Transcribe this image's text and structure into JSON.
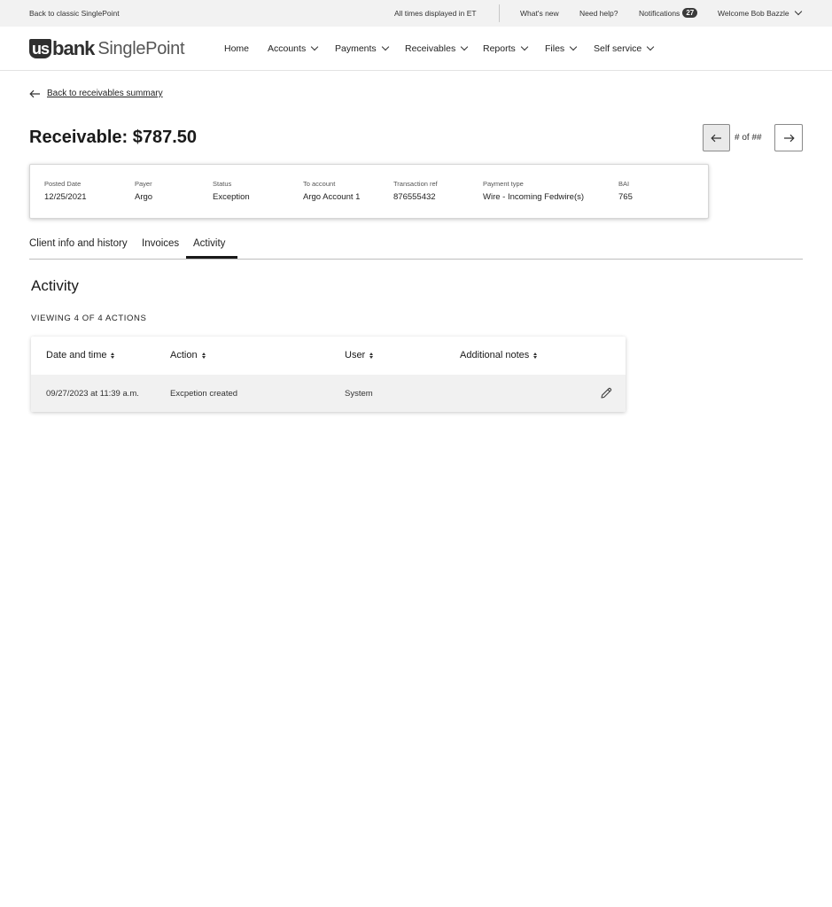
{
  "utility": {
    "back_classic": "Back to classic SinglePoint",
    "times_note": "All times displayed in ET",
    "whats_new": "What's new",
    "need_help": "Need help?",
    "notifications_label": "Notifications",
    "notifications_count": "27",
    "welcome": "Welcome Bob Bazzle"
  },
  "brand": {
    "us": "us",
    "bank": "bank",
    "product": "SinglePoint"
  },
  "nav": {
    "home": "Home",
    "accounts": "Accounts",
    "payments": "Payments",
    "receivables": "Receivables",
    "reports": "Reports",
    "files": "Files",
    "self_service": "Self service"
  },
  "back_link": "Back to receivables summary",
  "title": "Receivable: $787.50",
  "pager": {
    "text": "# of ##"
  },
  "summary": {
    "posted_date": {
      "label": "Posted Date",
      "value": "12/25/2021"
    },
    "payer": {
      "label": "Payer",
      "value": "Argo"
    },
    "status": {
      "label": "Status",
      "value": "Exception"
    },
    "to_account": {
      "label": "To account",
      "value": "Argo Account 1"
    },
    "transaction_ref": {
      "label": "Transaction ref",
      "value": "876555432"
    },
    "payment_type": {
      "label": "Payment type",
      "value": "Wire - Incoming Fedwire(s)"
    },
    "bai": {
      "label": "BAI",
      "value": "765"
    }
  },
  "tabs": {
    "client_info": "Client info and history",
    "invoices": "Invoices",
    "activity": "Activity",
    "active": "Activity"
  },
  "activity": {
    "section_title": "Activity",
    "viewing": "VIEWING 4 OF 4 ACTIONS",
    "columns": {
      "date_time": "Date and time",
      "action": "Action",
      "user": "User",
      "notes": "Additional notes"
    },
    "rows": [
      {
        "date_time": "09/27/2023 at 11:39 a.m.",
        "action": "Excpetion created",
        "user": "System",
        "notes": ""
      }
    ]
  },
  "icons": {
    "back": "arrow-left-icon",
    "prev": "arrow-left-icon",
    "next": "arrow-right-icon",
    "edit": "pencil-icon",
    "sort": "sort-icon",
    "chevron": "chevron-down-icon"
  }
}
